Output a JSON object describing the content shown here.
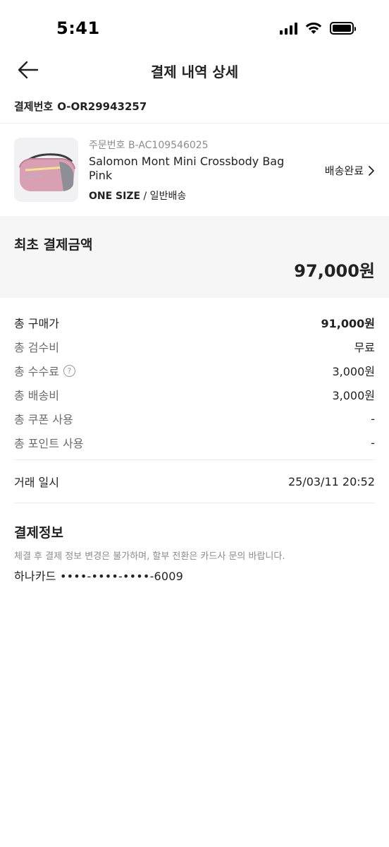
{
  "status_bar": {
    "time": "5:41"
  },
  "nav": {
    "title": "결제 내역 상세"
  },
  "payment": {
    "label": "결제번호",
    "number": "O-OR29943257"
  },
  "product": {
    "order_label": "주문번호 B-AC109546025",
    "name": "Salomon Mont Mini Crossbody Bag Pink",
    "size": "ONE SIZE",
    "shipping_type": "/ 일반배송",
    "status": "배송완료"
  },
  "total": {
    "label": "최초 결제금액",
    "amount": "97,000원"
  },
  "breakdown": [
    {
      "label": "총 구매가",
      "value": "91,000원"
    },
    {
      "label": "총 검수비",
      "value": "무료"
    },
    {
      "label": "총 수수료",
      "value": "3,000원"
    },
    {
      "label": "총 배송비",
      "value": "3,000원"
    },
    {
      "label": "총 쿠폰 사용",
      "value": "-"
    },
    {
      "label": "총 포인트 사용",
      "value": "-"
    }
  ],
  "trade": {
    "label": "거래 일시",
    "datetime": "25/03/11 20:52"
  },
  "payment_info": {
    "title": "결제정보",
    "note": "체결 후 결제 정보 변경은 불가하며, 할부 전환은 카드사 문의 바랍니다.",
    "card": "하나카드 ••••-••••-••••-6009"
  },
  "icons": {
    "back": "arrow-left-icon",
    "chevron": "chevron-right-icon",
    "help": "question-circle-icon",
    "signal": "cellular-signal-icon",
    "wifi": "wifi-icon",
    "battery": "battery-icon"
  }
}
